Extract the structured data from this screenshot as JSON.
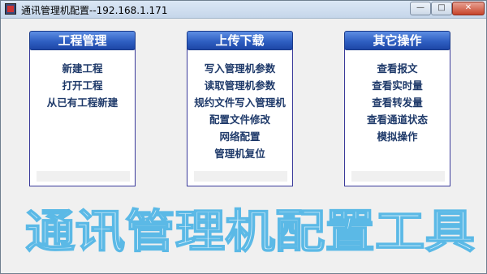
{
  "window": {
    "title": "通讯管理机配置--192.168.1.171",
    "controls": {
      "minimize": "—",
      "maximize": "□",
      "close": "✕"
    }
  },
  "panels": [
    {
      "header": "工程管理",
      "items": [
        "新建工程",
        "打开工程",
        "从已有工程新建"
      ]
    },
    {
      "header": "上传下载",
      "items": [
        "写入管理机参数",
        "读取管理机参数",
        "规约文件写入管理机",
        "配置文件修改",
        "网络配置",
        "管理机复位"
      ]
    },
    {
      "header": "其它操作",
      "items": [
        "查看报文",
        "查看实时量",
        "查看转发量",
        "查看通道状态",
        "模拟操作"
      ]
    }
  ],
  "banner": {
    "text": "通讯管理机配置工具",
    "color": "#5bb9e6"
  }
}
